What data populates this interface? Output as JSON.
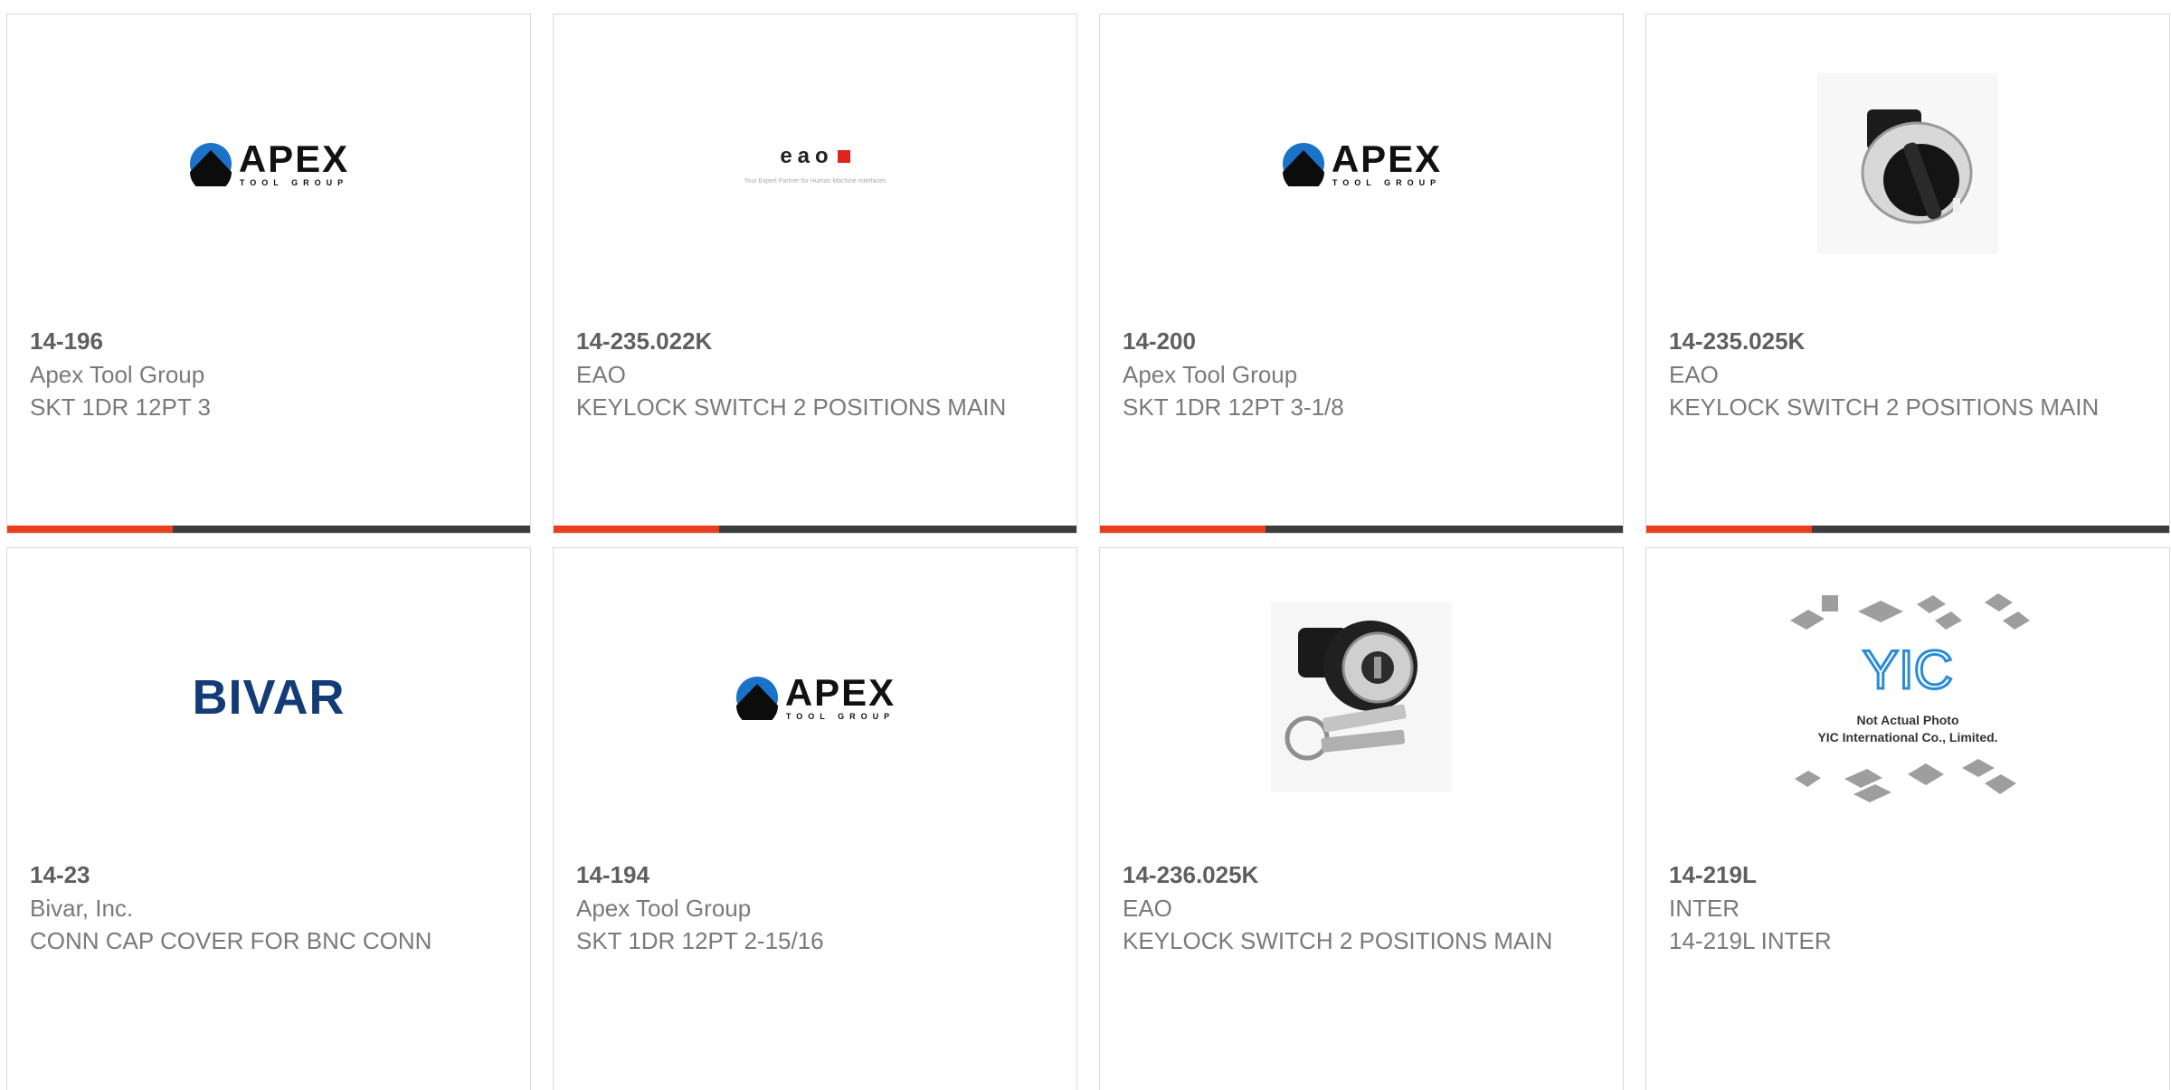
{
  "products": [
    {
      "part_number": "14-196",
      "manufacturer": "Apex Tool Group",
      "description": "SKT 1DR 12PT 3",
      "image": "apex-logo"
    },
    {
      "part_number": "14-235.022K",
      "manufacturer": "EAO",
      "description": "KEYLOCK SWITCH 2 POSITIONS MAIN",
      "image": "eao-logo"
    },
    {
      "part_number": "14-200",
      "manufacturer": "Apex Tool Group",
      "description": "SKT 1DR 12PT 3-1/8",
      "image": "apex-logo"
    },
    {
      "part_number": "14-235.025K",
      "manufacturer": "EAO",
      "description": "KEYLOCK SWITCH 2 POSITIONS MAIN",
      "image": "selector-switch-photo"
    },
    {
      "part_number": "14-23",
      "manufacturer": "Bivar, Inc.",
      "description": "CONN CAP COVER FOR BNC CONN",
      "image": "bivar-logo"
    },
    {
      "part_number": "14-194",
      "manufacturer": "Apex Tool Group",
      "description": "SKT 1DR 12PT 2-15/16",
      "image": "apex-logo"
    },
    {
      "part_number": "14-236.025K",
      "manufacturer": "EAO",
      "description": "KEYLOCK SWITCH 2 POSITIONS MAIN",
      "image": "keylock-switch-photo"
    },
    {
      "part_number": "14-219L",
      "manufacturer": "INTER",
      "description": "14-219L INTER",
      "image": "yic-placeholder"
    }
  ],
  "logos": {
    "apex_main": "APEX",
    "apex_sub": "TOOL GROUP",
    "eao_main": "eao",
    "eao_tagline": "Your Expert Partner for Human Machine Interfaces",
    "bivar": "BIVAR",
    "yic_line1": "Not Actual Photo",
    "yic_line2": "YIC International Co., Limited.",
    "yic_mark": "YIC"
  },
  "colors": {
    "accent": "#e8401c",
    "bar": "#3d3d3d",
    "border": "#d9d9d9",
    "bivar": "#123b78",
    "eao_red": "#e0231c"
  }
}
